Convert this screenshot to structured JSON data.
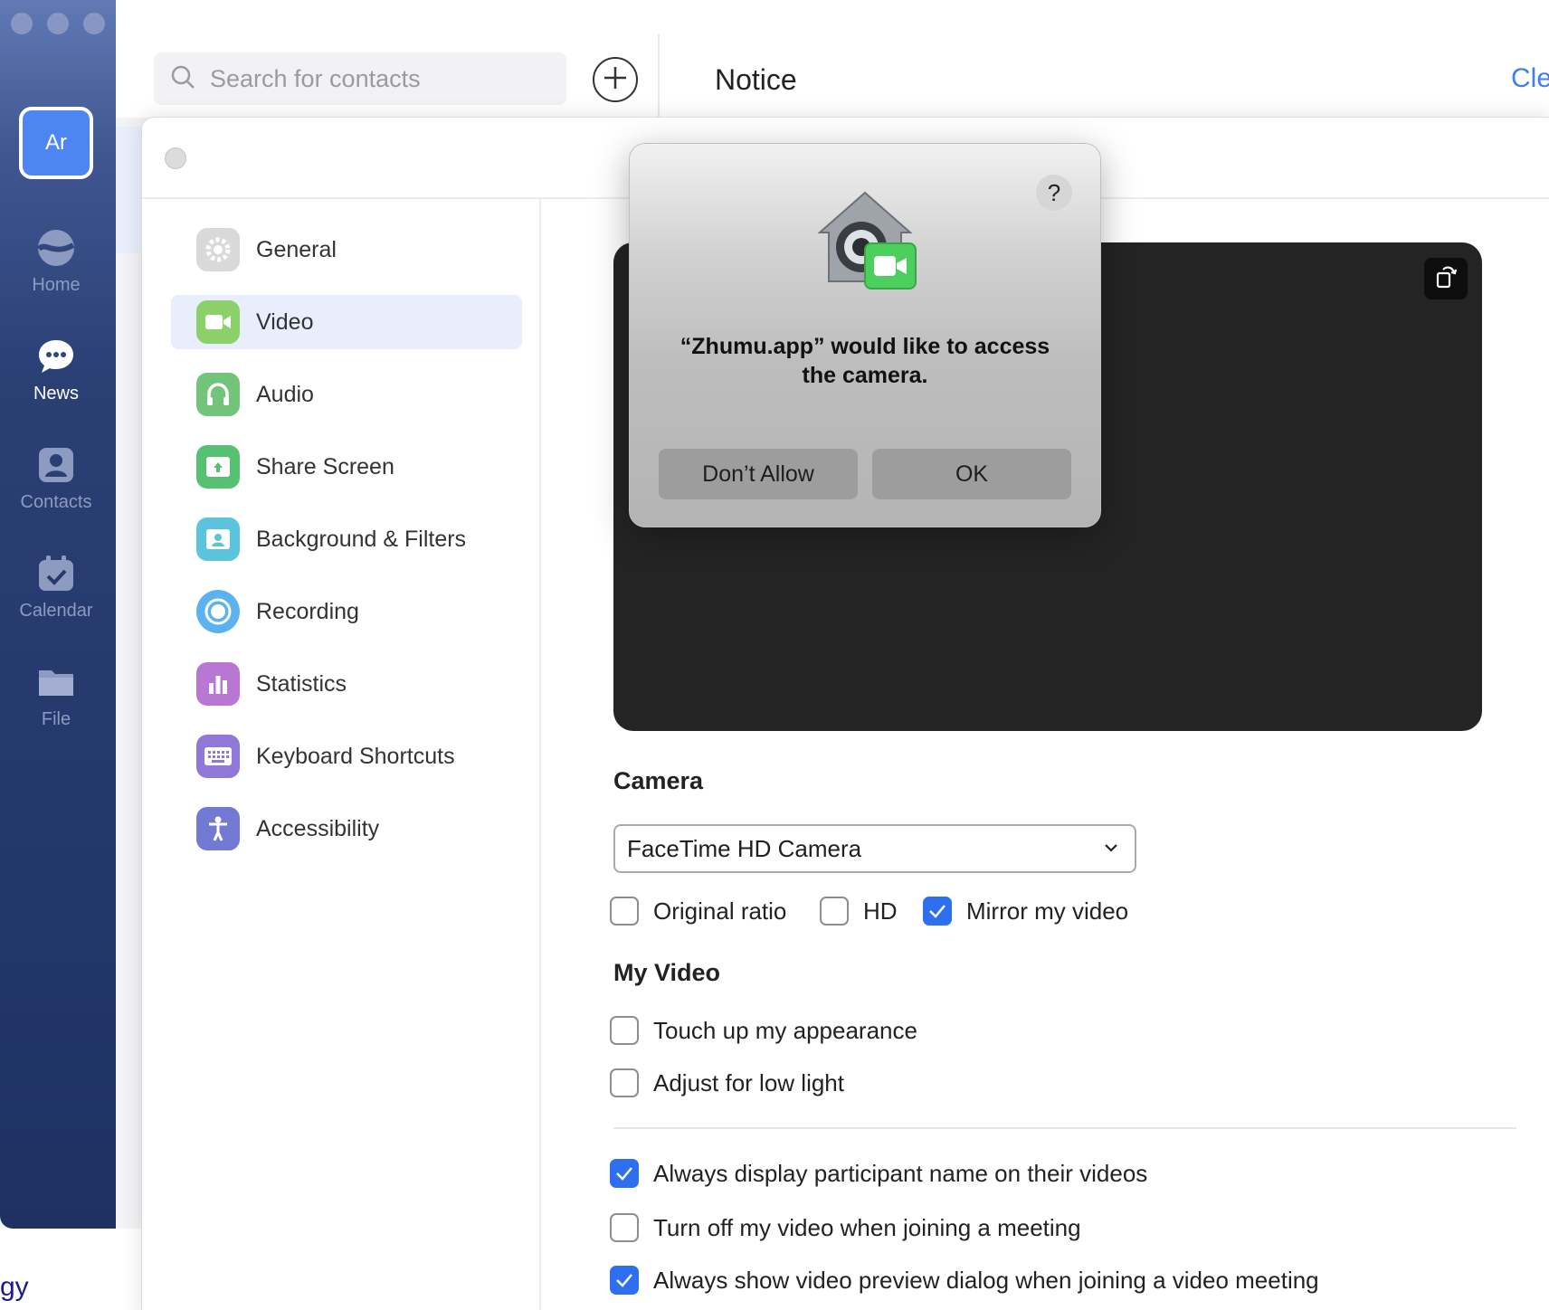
{
  "rail": {
    "avatar_initials": "Ar",
    "items": [
      {
        "label": "Home",
        "icon": "home-icon"
      },
      {
        "label": "News",
        "icon": "chat-bubble-icon",
        "active": true
      },
      {
        "label": "Contacts",
        "icon": "contact-card-icon"
      },
      {
        "label": "Calendar",
        "icon": "calendar-icon"
      },
      {
        "label": "File",
        "icon": "folder-icon"
      }
    ]
  },
  "topbar": {
    "search_placeholder": "Search for contacts",
    "notice_title": "Notice",
    "clear_link": "Cle"
  },
  "background": {
    "snippet": "gy"
  },
  "settings": {
    "menu": [
      {
        "label": "General",
        "icon": "gear-icon",
        "color": "#bdbdbd"
      },
      {
        "label": "Video",
        "icon": "video-camera-icon",
        "color": "#7cc55f",
        "selected": true
      },
      {
        "label": "Audio",
        "icon": "headphones-icon",
        "color": "#6fbf6a"
      },
      {
        "label": "Share Screen",
        "icon": "share-screen-icon",
        "color": "#4fbf6d"
      },
      {
        "label": "Background & Filters",
        "icon": "person-portrait-icon",
        "color": "#4fb8d9"
      },
      {
        "label": "Recording",
        "icon": "record-icon",
        "color": "#4fa9ee"
      },
      {
        "label": "Statistics",
        "icon": "bar-chart-icon",
        "color": "#b068cf"
      },
      {
        "label": "Keyboard Shortcuts",
        "icon": "keyboard-icon",
        "color": "#8a6fd6"
      },
      {
        "label": "Accessibility",
        "icon": "accessibility-icon",
        "color": "#6a72d0"
      }
    ],
    "video": {
      "camera_heading": "Camera",
      "camera_value": "FaceTime HD Camera",
      "options": [
        {
          "label": "Original ratio",
          "checked": false
        },
        {
          "label": "HD",
          "checked": false
        },
        {
          "label": "Mirror my video",
          "checked": true
        }
      ],
      "my_video_heading": "My Video",
      "my_video_options": [
        {
          "label": "Touch up my appearance",
          "checked": false
        },
        {
          "label": "Adjust for low light",
          "checked": false
        }
      ],
      "general_options": [
        {
          "label": "Always display participant name on their videos",
          "checked": true
        },
        {
          "label": "Turn off my video when joining a meeting",
          "checked": false
        },
        {
          "label": "Always show video preview dialog when joining a video meeting",
          "checked": true
        }
      ]
    }
  },
  "dialog": {
    "message": "“Zhumu.app” would like to access the camera.",
    "help": "?",
    "deny_label": "Don’t Allow",
    "ok_label": "OK"
  }
}
